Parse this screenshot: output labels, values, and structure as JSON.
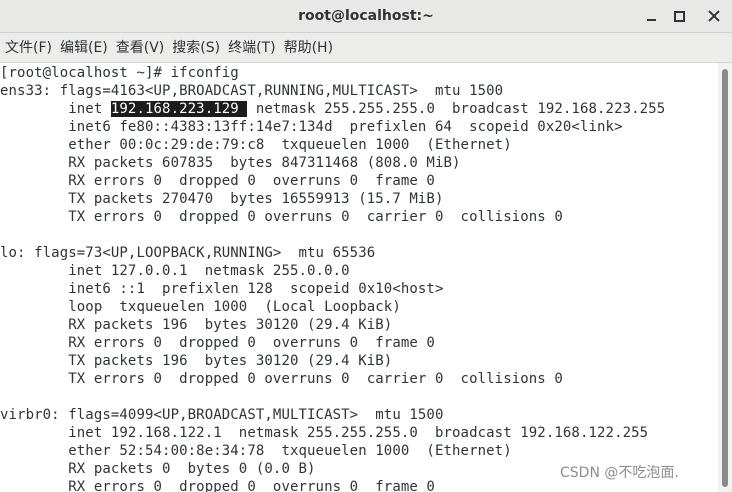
{
  "window": {
    "title": "root@localhost:~",
    "minimize_icon": "minimize-icon",
    "maximize_icon": "maximize-icon",
    "close_icon": "close-icon"
  },
  "menubar": {
    "items": [
      {
        "label": "文件(F)"
      },
      {
        "label": "编辑(E)"
      },
      {
        "label": "查看(V)"
      },
      {
        "label": "搜索(S)"
      },
      {
        "label": "终端(T)"
      },
      {
        "label": "帮助(H)"
      }
    ]
  },
  "terminal": {
    "lines": [
      {
        "pre": "[root@localhost ~]# ifconfig",
        "hl": "",
        "post": ""
      },
      {
        "pre": "ens33: flags=4163<UP,BROADCAST,RUNNING,MULTICAST>  mtu 1500",
        "hl": "",
        "post": ""
      },
      {
        "pre": "        inet ",
        "hl": "192.168.223.129 ",
        "post": " netmask 255.255.255.0  broadcast 192.168.223.255"
      },
      {
        "pre": "        inet6 fe80::4383:13ff:14e7:134d  prefixlen 64  scopeid 0x20<link>",
        "hl": "",
        "post": ""
      },
      {
        "pre": "        ether 00:0c:29:de:79:c8  txqueuelen 1000  (Ethernet)",
        "hl": "",
        "post": ""
      },
      {
        "pre": "        RX packets 607835  bytes 847311468 (808.0 MiB)",
        "hl": "",
        "post": ""
      },
      {
        "pre": "        RX errors 0  dropped 0  overruns 0  frame 0",
        "hl": "",
        "post": ""
      },
      {
        "pre": "        TX packets 270470  bytes 16559913 (15.7 MiB)",
        "hl": "",
        "post": ""
      },
      {
        "pre": "        TX errors 0  dropped 0 overruns 0  carrier 0  collisions 0",
        "hl": "",
        "post": ""
      },
      {
        "pre": "",
        "hl": "",
        "post": ""
      },
      {
        "pre": "lo: flags=73<UP,LOOPBACK,RUNNING>  mtu 65536",
        "hl": "",
        "post": ""
      },
      {
        "pre": "        inet 127.0.0.1  netmask 255.0.0.0",
        "hl": "",
        "post": ""
      },
      {
        "pre": "        inet6 ::1  prefixlen 128  scopeid 0x10<host>",
        "hl": "",
        "post": ""
      },
      {
        "pre": "        loop  txqueuelen 1000  (Local Loopback)",
        "hl": "",
        "post": ""
      },
      {
        "pre": "        RX packets 196  bytes 30120 (29.4 KiB)",
        "hl": "",
        "post": ""
      },
      {
        "pre": "        RX errors 0  dropped 0  overruns 0  frame 0",
        "hl": "",
        "post": ""
      },
      {
        "pre": "        TX packets 196  bytes 30120 (29.4 KiB)",
        "hl": "",
        "post": ""
      },
      {
        "pre": "        TX errors 0  dropped 0 overruns 0  carrier 0  collisions 0",
        "hl": "",
        "post": ""
      },
      {
        "pre": "",
        "hl": "",
        "post": ""
      },
      {
        "pre": "virbr0: flags=4099<UP,BROADCAST,MULTICAST>  mtu 1500",
        "hl": "",
        "post": ""
      },
      {
        "pre": "        inet 192.168.122.1  netmask 255.255.255.0  broadcast 192.168.122.255",
        "hl": "",
        "post": ""
      },
      {
        "pre": "        ether 52:54:00:8e:34:78  txqueuelen 1000  (Ethernet)",
        "hl": "",
        "post": ""
      },
      {
        "pre": "        RX packets 0  bytes 0 (0.0 B)",
        "hl": "",
        "post": ""
      },
      {
        "pre": "        RX errors 0  dropped 0  overruns 0  frame 0",
        "hl": "",
        "post": ""
      }
    ]
  },
  "watermark": "CSDN @不吃泡面.",
  "colors": {
    "titlebar_bg": "#e8e8e7",
    "menubar_bg": "#ececeb",
    "terminal_bg": "#ffffff",
    "terminal_fg": "#2e3436",
    "selection_bg": "#1c1c1c",
    "selection_fg": "#ffffff"
  }
}
